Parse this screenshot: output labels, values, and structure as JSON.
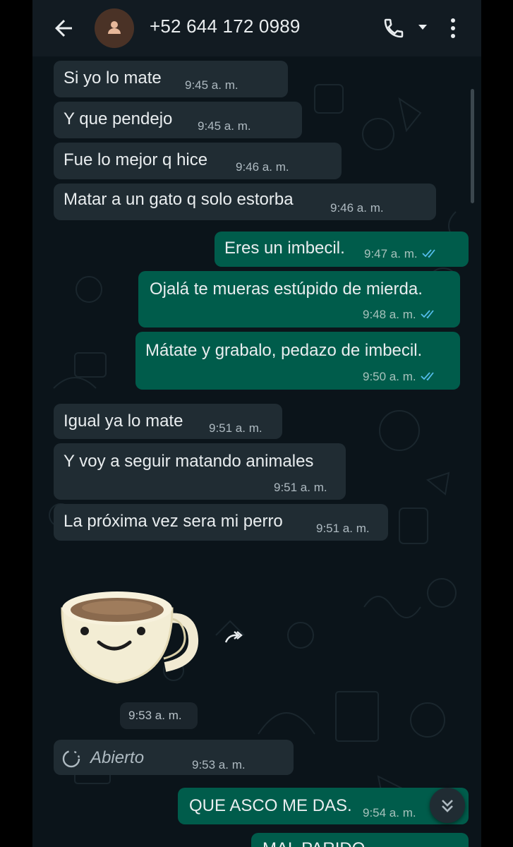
{
  "header": {
    "contact_name": "+52 644 172 0989"
  },
  "messages": [
    {
      "text": "Si yo lo mate",
      "time": "9:45 a. m."
    },
    {
      "text": "Y que pendejo",
      "time": "9:45 a. m."
    },
    {
      "text": "Fue lo mejor q hice",
      "time": "9:46 a. m."
    },
    {
      "text": "Matar a un gato q solo estorba",
      "time": "9:46 a. m."
    },
    {
      "text": "Eres un imbecil.",
      "time": "9:47 a. m."
    },
    {
      "text": "Ojalá te mueras estúpido de mierda.",
      "time": "9:48 a. m."
    },
    {
      "text": "Mátate y grabalo, pedazo de imbecil.",
      "time": "9:50 a. m."
    },
    {
      "text": "Igual ya lo mate",
      "time": "9:51 a. m."
    },
    {
      "text": "Y voy a seguir matando animales",
      "time": "9:51 a. m."
    },
    {
      "text": "La próxima vez sera mi perro",
      "time": "9:51 a. m."
    },
    {
      "text": "QUE ASCO ME DAS.",
      "time": "9:54 a. m."
    },
    {
      "text": "MAL PARIDO"
    }
  ],
  "sticker": {
    "icon": "coffee-cup-sticker",
    "time": "9:53 a. m."
  },
  "view_once": {
    "label": "Abierto",
    "time": "9:53 a. m."
  },
  "colors": {
    "background": "#0b141a",
    "header": "#121b22",
    "incoming_bubble": "#202c33",
    "outgoing_bubble": "#005c4b",
    "read_ticks": "#53bdeb"
  }
}
